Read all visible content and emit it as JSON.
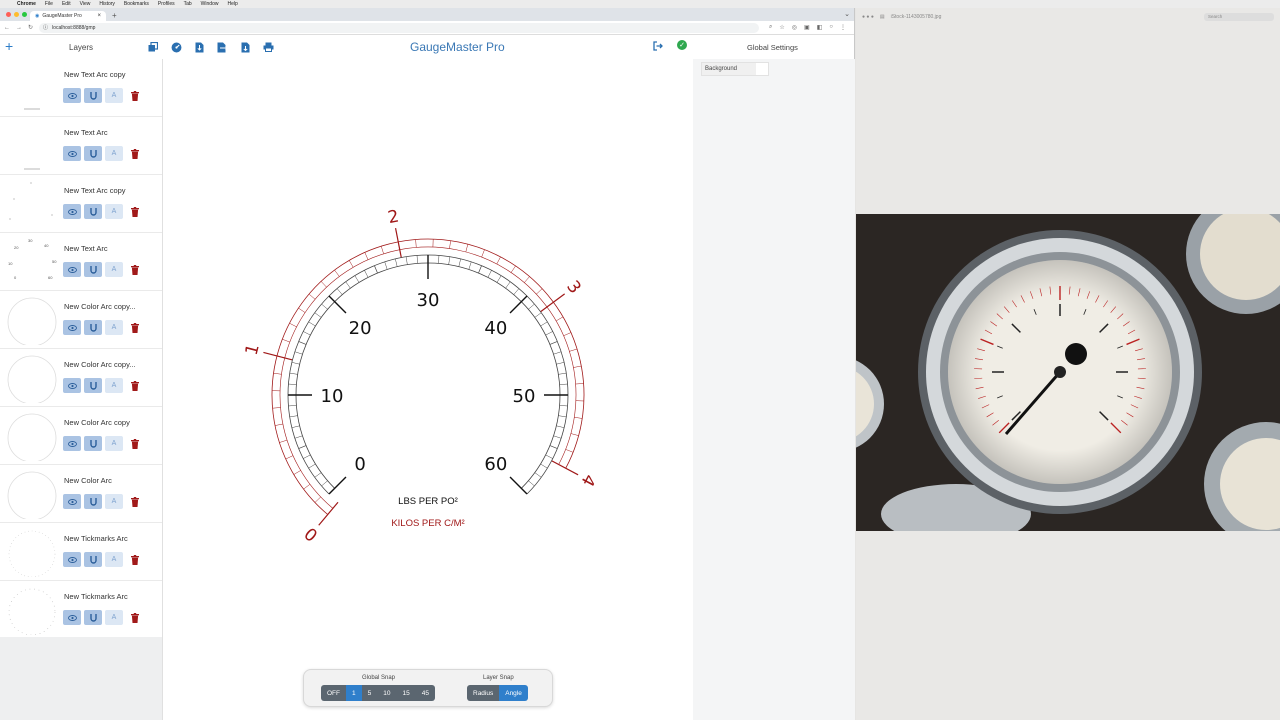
{
  "menubar": {
    "app": "Chrome",
    "items": [
      "File",
      "Edit",
      "View",
      "History",
      "Bookmarks",
      "Profiles",
      "Tab",
      "Window",
      "Help"
    ]
  },
  "browser": {
    "tab_title": "GaugeMaster Pro",
    "url": "localhost:8888/gmp"
  },
  "app": {
    "title": "GaugeMaster Pro",
    "layers_title": "Layers",
    "settings_title": "Global Settings"
  },
  "layers": [
    {
      "name": "New Text Arc copy"
    },
    {
      "name": "New Text Arc"
    },
    {
      "name": "New Text Arc copy"
    },
    {
      "name": "New Text Arc"
    },
    {
      "name": "New Color Arc copy..."
    },
    {
      "name": "New Color Arc copy..."
    },
    {
      "name": "New Color Arc copy"
    },
    {
      "name": "New Color Arc"
    },
    {
      "name": "New Tickmarks Arc"
    },
    {
      "name": "New Tickmarks Arc"
    }
  ],
  "gauge": {
    "inner_labels": [
      "0",
      "10",
      "20",
      "30",
      "40",
      "50",
      "60"
    ],
    "outer_labels": [
      "0",
      "1",
      "2",
      "3",
      "4"
    ],
    "unit_primary": "LBS PER PO²",
    "unit_secondary": "KILOS PER C/M²",
    "colors": {
      "primary": "#111111",
      "secondary": "#a01818"
    }
  },
  "snap": {
    "global_label": "Global Snap",
    "global_options": [
      "OFF",
      "1",
      "5",
      "10",
      "15",
      "45"
    ],
    "global_selected": "1",
    "layer_label": "Layer Snap",
    "layer_options": [
      "Radius",
      "Angle"
    ],
    "layer_selected": "Angle"
  },
  "settings": {
    "background_label": "Background"
  },
  "preview": {
    "filename": "iStock-1143005780.jpg",
    "search_placeholder": "Search"
  },
  "accent": "#2f7fcb"
}
